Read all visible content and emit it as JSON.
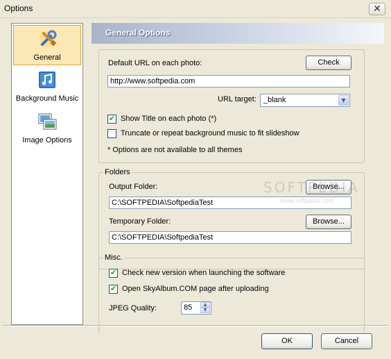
{
  "window": {
    "title": "Options",
    "close_glyph": "✕"
  },
  "sidebar": {
    "items": [
      {
        "label": "General",
        "icon": "general-tools-icon",
        "selected": true
      },
      {
        "label": "Background Music",
        "icon": "music-note-icon",
        "selected": false
      },
      {
        "label": "Image Options",
        "icon": "images-icon",
        "selected": false
      }
    ]
  },
  "header": {
    "title": "General Options"
  },
  "general": {
    "default_url_label": "Default URL on each photo:",
    "check_button": "Check",
    "default_url_value": "http://www.softpedia.com",
    "url_target_label": "URL target:",
    "url_target_value": "_blank",
    "show_title_label": "Show Title on each photo (*)",
    "show_title_checked": true,
    "truncate_label": "Truncate or repeat background music to fit slideshow",
    "truncate_checked": false,
    "note": "* Options are not available to all themes"
  },
  "folders": {
    "legend": "Folders",
    "output_label": "Output Folder:",
    "output_browse": "Browse...",
    "output_value": "C:\\SOFTPEDIA\\SoftpediaTest",
    "temp_label": "Temporary Folder:",
    "temp_browse": "Browse...",
    "temp_value": "C:\\SOFTPEDIA\\SoftpediaTest"
  },
  "misc": {
    "legend": "Misc.",
    "check_version_label": "Check new version when launching the software",
    "check_version_checked": true,
    "open_page_label": "Open SkyAlbum.COM page after uploading",
    "open_page_checked": true,
    "jpeg_label": "JPEG Quality:",
    "jpeg_value": "85"
  },
  "footer": {
    "ok": "OK",
    "cancel": "Cancel"
  },
  "watermark": {
    "text": "SOFTPEDIA",
    "sub": "www.softpedia.com"
  }
}
